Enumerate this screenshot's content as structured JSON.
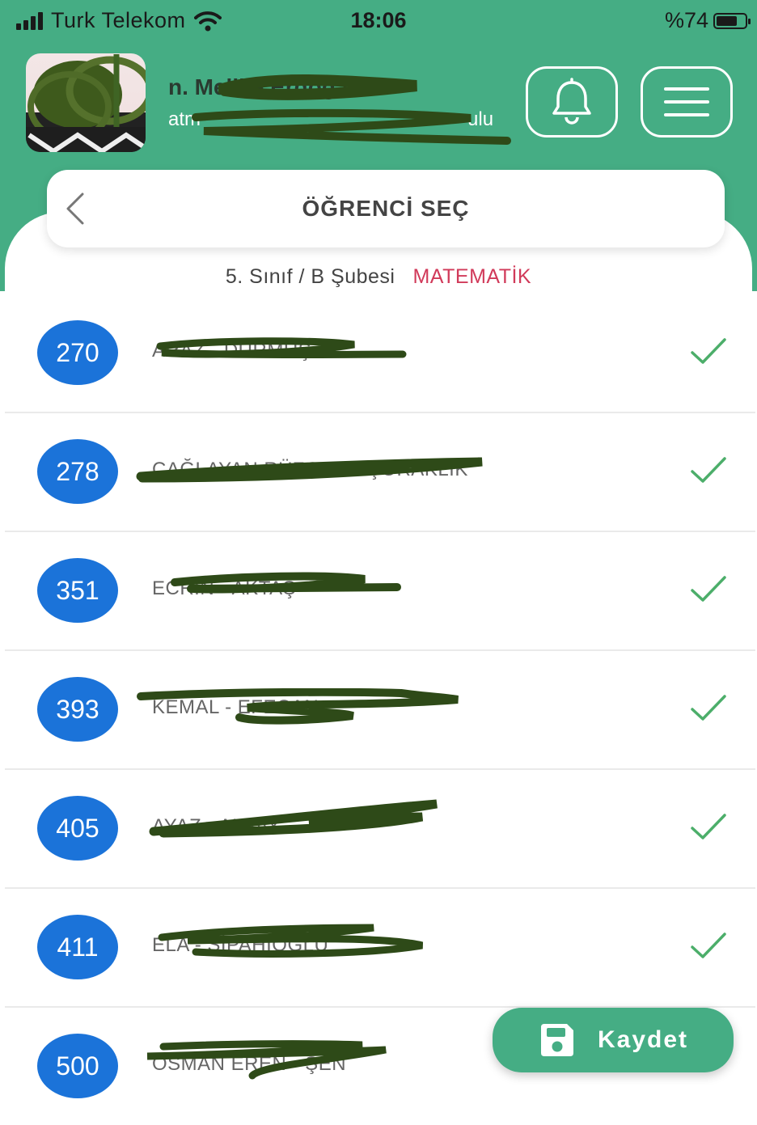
{
  "status_bar": {
    "carrier": "Turk Telekom",
    "time": "18:06",
    "battery": "%74",
    "battery_level": 0.74
  },
  "header": {
    "teacher_name": "n. Melike Erdoğan",
    "school_name": "atm",
    "school_suffix": "ulu",
    "bell_icon": "bell-icon",
    "menu_icon": "hamburger-menu-icon"
  },
  "page": {
    "title": "ÖĞRENCİ SEÇ",
    "back_icon": "chevron-left-icon",
    "class_info": "5. Sınıf / B Şubesi",
    "subject": "MATEMATİK"
  },
  "students": [
    {
      "number": "270",
      "name": "ARAZ - DURMUŞ",
      "checked": true
    },
    {
      "number": "278",
      "name": "ÇAĞLAYAN RÜZGAR - ÇORAKLIK",
      "checked": true
    },
    {
      "number": "351",
      "name": "ECRİN - AKTAŞ",
      "checked": true
    },
    {
      "number": "393",
      "name": "KEMAL - EFECAN",
      "checked": true
    },
    {
      "number": "405",
      "name": "AYAZ - ALPAY",
      "checked": true
    },
    {
      "number": "411",
      "name": "ELA - SİPAHİOĞLU",
      "checked": true
    },
    {
      "number": "500",
      "name": "OSMAN EREN - ŞEN",
      "checked": false
    }
  ],
  "actions": {
    "save_label": "Kaydet",
    "save_icon": "floppy-disk-icon"
  },
  "colors": {
    "header_green": "#45ad84",
    "badge_blue": "#1b73d9",
    "subject_red": "#d13a5a",
    "check_green": "#4cae6a"
  }
}
